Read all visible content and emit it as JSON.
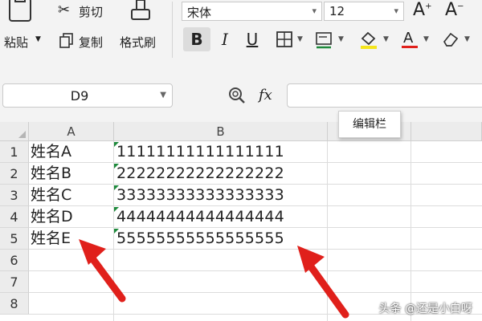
{
  "ribbon": {
    "paste_label": "粘贴",
    "cut_label": "剪切",
    "copy_label": "复制",
    "format_painter_label": "格式刷",
    "font_name": "宋体",
    "font_size": "12",
    "grow_font": "A",
    "shrink_font": "A",
    "bold": "B",
    "italic": "I",
    "underline": "U"
  },
  "formula_bar": {
    "name_box": "D9",
    "fx_label": "fx",
    "tooltip": "编辑栏"
  },
  "sheet": {
    "columns": [
      "A",
      "B"
    ],
    "rows": [
      {
        "n": "1",
        "a": "姓名A",
        "b": "11111111111111111"
      },
      {
        "n": "2",
        "a": "姓名B",
        "b": "22222222222222222"
      },
      {
        "n": "3",
        "a": "姓名C",
        "b": "33333333333333333"
      },
      {
        "n": "4",
        "a": "姓名D",
        "b": "44444444444444444"
      },
      {
        "n": "5",
        "a": "姓名E",
        "b": "55555555555555555"
      },
      {
        "n": "6",
        "a": "",
        "b": ""
      },
      {
        "n": "7",
        "a": "",
        "b": ""
      },
      {
        "n": "8",
        "a": "",
        "b": ""
      }
    ]
  },
  "watermark": "头条 @还是小白呀",
  "colors": {
    "error_triangle": "#1e8a3c",
    "annotation_arrow": "#e0201b",
    "font_color_underline": "#e0201b",
    "highlight_underline": "#f5e51c"
  }
}
